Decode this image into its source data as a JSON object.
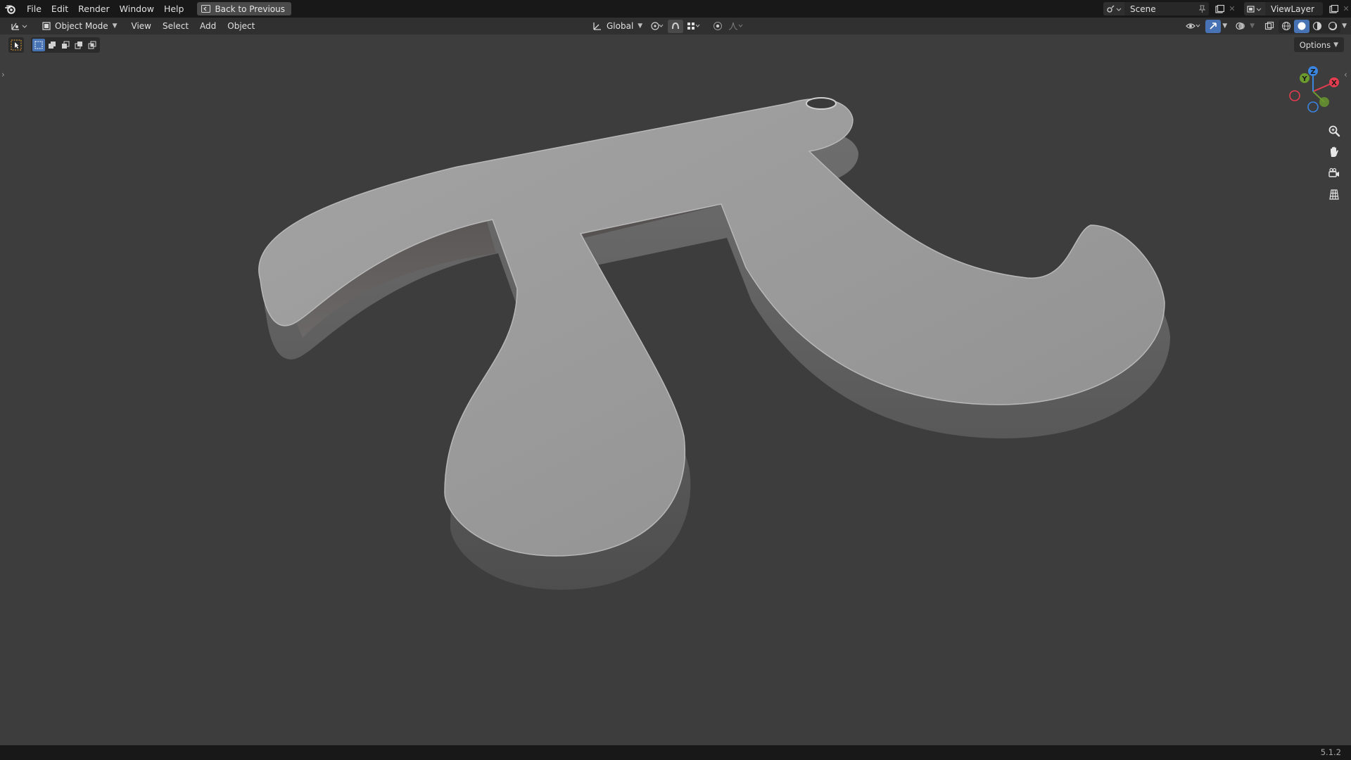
{
  "topbar": {
    "menus": [
      "File",
      "Edit",
      "Render",
      "Window",
      "Help"
    ],
    "back_button": "Back to Previous",
    "scene_name": "Scene",
    "view_layer": "ViewLayer"
  },
  "header": {
    "mode": "Object Mode",
    "menus": [
      "View",
      "Select",
      "Add",
      "Object"
    ],
    "orientation": "Global",
    "options_label": "Options"
  },
  "status": {
    "version": "5.1.2"
  },
  "gizmo": {
    "x_label": "X",
    "y_label": "Y",
    "z_label": "Z",
    "colors": {
      "x": "#e23c4f",
      "y": "#6b9b2e",
      "z": "#3a85e0"
    }
  },
  "icons": {
    "logo": "blender-logo-icon",
    "zoom": "zoom-icon",
    "pan": "hand-icon",
    "camera": "camera-icon",
    "grid": "ortho-grid-icon"
  }
}
